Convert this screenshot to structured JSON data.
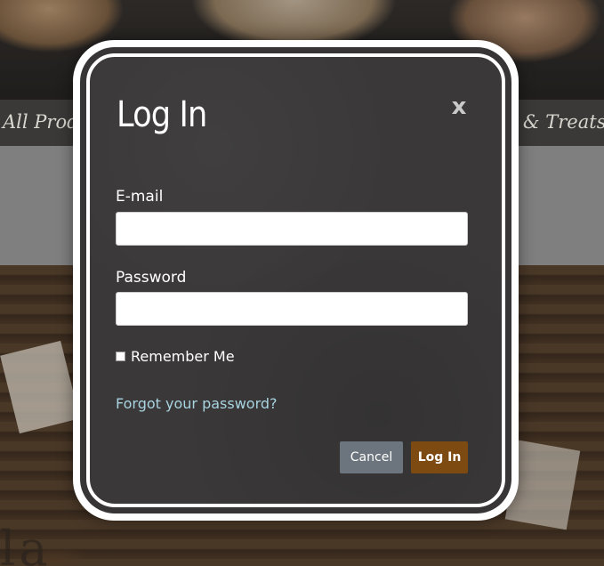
{
  "background": {
    "nav": {
      "left_text": "All Produc",
      "right_text": "ts & Treats"
    },
    "photo_text": "la"
  },
  "modal": {
    "title": "Log In",
    "close_glyph": "x",
    "email": {
      "label": "E-mail",
      "value": "",
      "placeholder": ""
    },
    "password": {
      "label": "Password",
      "value": "",
      "placeholder": ""
    },
    "remember_me": {
      "label": "Remember Me",
      "checked": false
    },
    "forgot_password": "Forgot your password?",
    "buttons": {
      "cancel": "Cancel",
      "login": "Log In"
    }
  },
  "colors": {
    "modal_background": "#3a3838",
    "modal_border": "#ffffff",
    "link": "#a8d3e1",
    "cancel_button": "#6c757d",
    "login_button": "#7d4a12"
  },
  "icons": {
    "close": "close-icon"
  }
}
